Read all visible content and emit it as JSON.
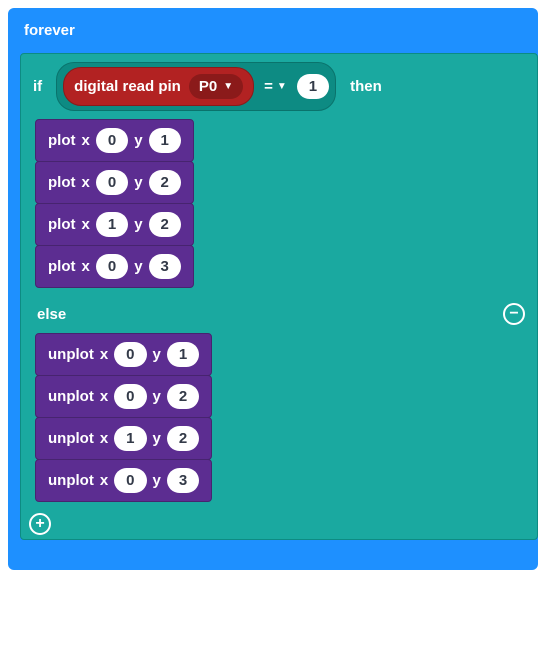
{
  "forever": {
    "label": "forever"
  },
  "if": {
    "if_label": "if",
    "then_label": "then",
    "else_label": "else",
    "condition": {
      "read_label": "digital read pin",
      "pin_value": "P0",
      "op": "=",
      "rhs": "1"
    }
  },
  "then_blocks": [
    {
      "cmd": "plot",
      "x": "0",
      "y": "1"
    },
    {
      "cmd": "plot",
      "x": "0",
      "y": "2"
    },
    {
      "cmd": "plot",
      "x": "1",
      "y": "2"
    },
    {
      "cmd": "plot",
      "x": "0",
      "y": "3"
    }
  ],
  "else_blocks": [
    {
      "cmd": "unplot",
      "x": "0",
      "y": "1"
    },
    {
      "cmd": "unplot",
      "x": "0",
      "y": "2"
    },
    {
      "cmd": "unplot",
      "x": "1",
      "y": "2"
    },
    {
      "cmd": "unplot",
      "x": "0",
      "y": "3"
    }
  ],
  "labels": {
    "x": "x",
    "y": "y"
  }
}
